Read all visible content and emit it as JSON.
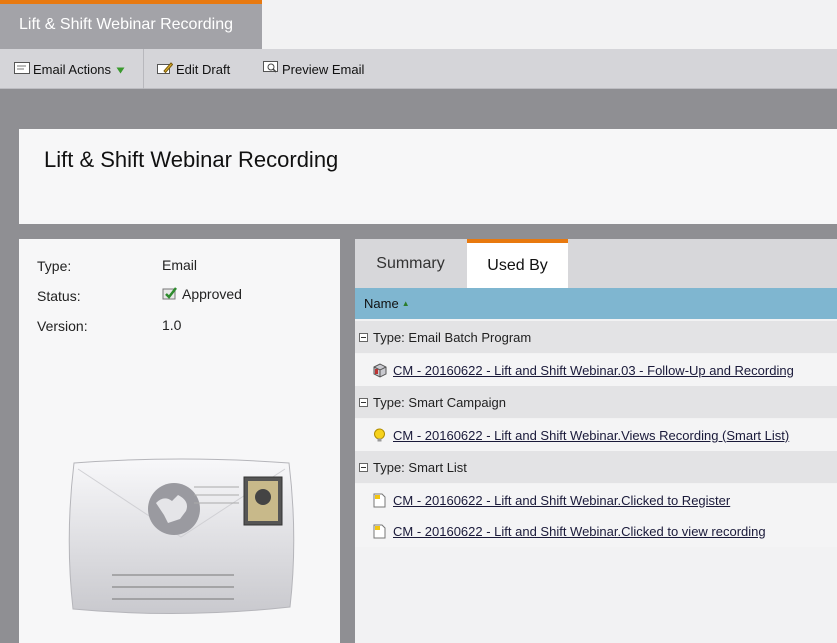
{
  "tab": {
    "title": "Lift & Shift Webinar Recording"
  },
  "toolbar": {
    "email_actions": "Email Actions",
    "edit_draft": "Edit Draft",
    "preview_email": "Preview Email"
  },
  "header": {
    "title": "Lift & Shift Webinar Recording"
  },
  "info": {
    "type_label": "Type:",
    "type_value": "Email",
    "status_label": "Status:",
    "status_value": "Approved",
    "version_label": "Version:",
    "version_value": "1.0"
  },
  "right_tabs": [
    "Summary",
    "Used By"
  ],
  "table": {
    "column": "Name",
    "groups": [
      {
        "label": "Type: Email Batch Program",
        "icon": "program-icon",
        "items": [
          "CM - 20160622 - Lift and Shift Webinar.03 - Follow-Up and Recording"
        ]
      },
      {
        "label": "Type: Smart Campaign",
        "icon": "lightbulb-icon",
        "items": [
          "CM - 20160622 - Lift and Shift Webinar.Views Recording (Smart List)"
        ]
      },
      {
        "label": "Type: Smart List",
        "icon": "smart-list-icon",
        "items": [
          "CM - 20160622 - Lift and Shift Webinar.Clicked to Register",
          "CM - 20160622 - Lift and Shift Webinar.Clicked to view recording"
        ]
      }
    ]
  },
  "colors": {
    "accent": "#e8790f",
    "header_blue": "#7fb6d0",
    "background": "#8f8f93"
  }
}
